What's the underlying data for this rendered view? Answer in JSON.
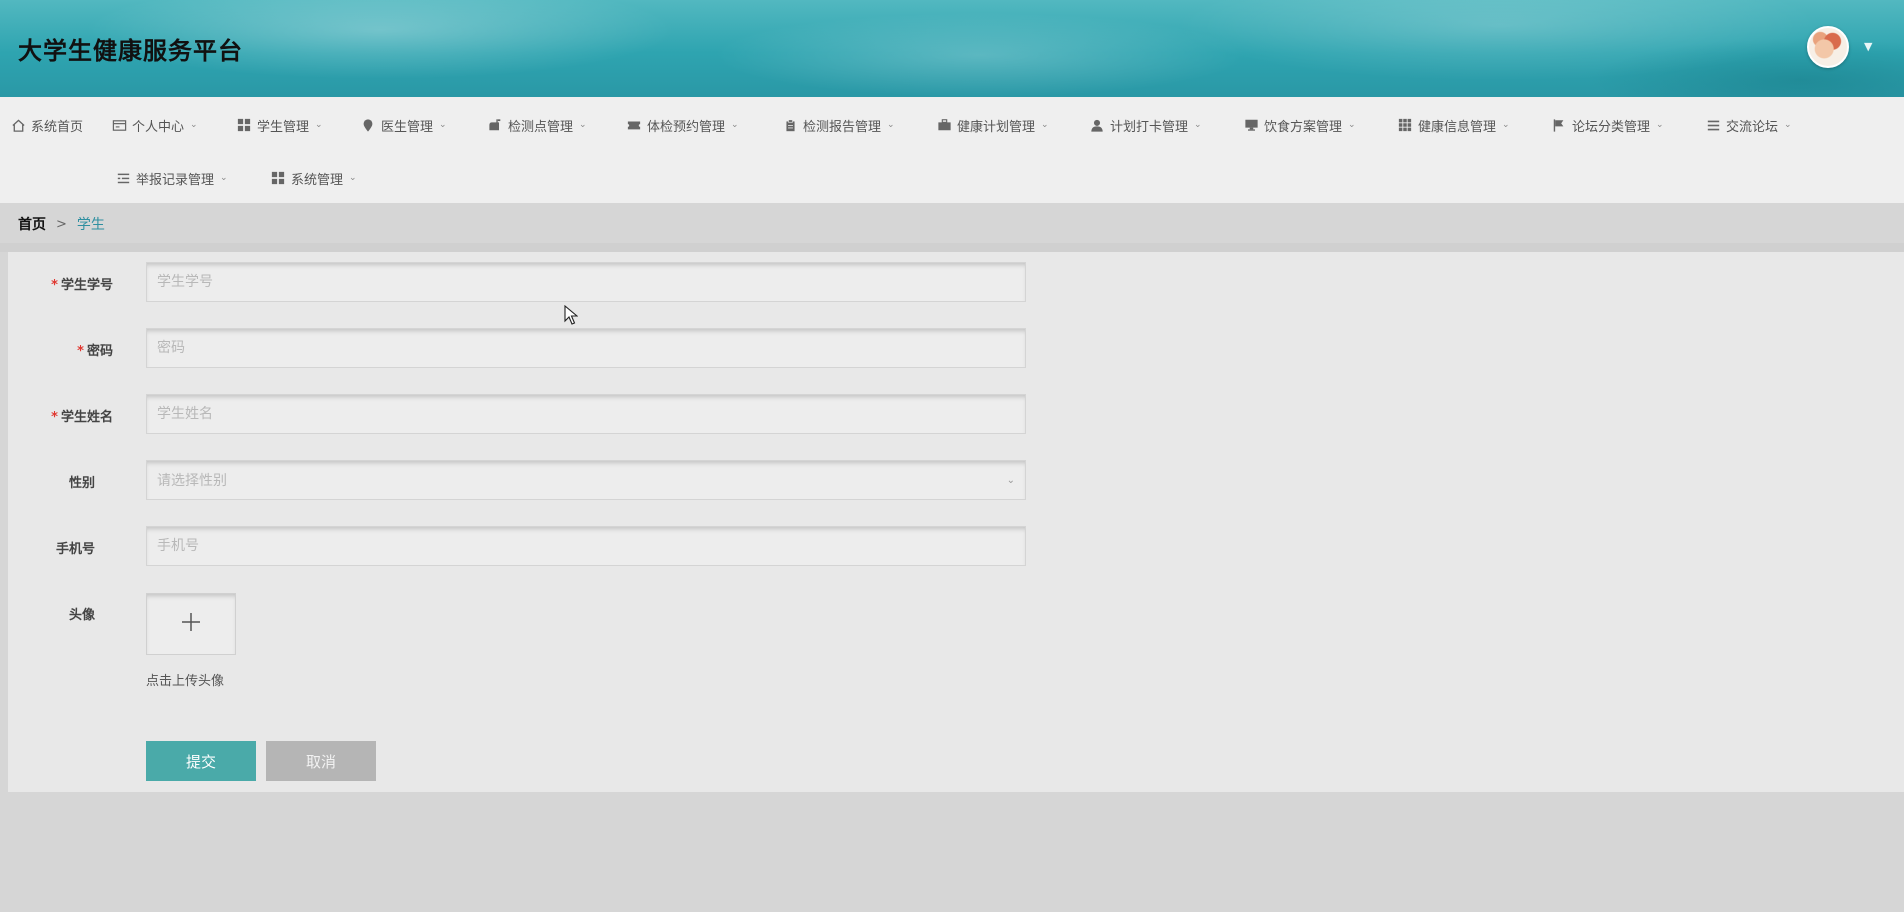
{
  "header": {
    "title": "大学生健康服务平台",
    "avatar_icon": "avatar-image",
    "menu_caret_icon": "caret-down-icon"
  },
  "nav": {
    "items": [
      {
        "label": "系统首页",
        "icon": "home-icon",
        "has_dropdown": false
      },
      {
        "label": "个人中心",
        "icon": "id-card-icon",
        "has_dropdown": true
      },
      {
        "label": "学生管理",
        "icon": "grid-icon",
        "has_dropdown": true
      },
      {
        "label": "医生管理",
        "icon": "map-pin-icon",
        "has_dropdown": true
      },
      {
        "label": "检测点管理",
        "icon": "mailbox-icon",
        "has_dropdown": true
      },
      {
        "label": "体检预约管理",
        "icon": "ticket-icon",
        "has_dropdown": true
      },
      {
        "label": "检测报告管理",
        "icon": "clipboard-icon",
        "has_dropdown": true
      },
      {
        "label": "健康计划管理",
        "icon": "briefcase-icon",
        "has_dropdown": true
      },
      {
        "label": "计划打卡管理",
        "icon": "user-icon",
        "has_dropdown": true
      },
      {
        "label": "饮食方案管理",
        "icon": "monitor-icon",
        "has_dropdown": true
      },
      {
        "label": "健康信息管理",
        "icon": "grid-dots-icon",
        "has_dropdown": true
      },
      {
        "label": "论坛分类管理",
        "icon": "flag-icon",
        "has_dropdown": true
      },
      {
        "label": "交流论坛",
        "icon": "list-icon",
        "has_dropdown": true
      },
      {
        "label": "举报记录管理",
        "icon": "list-details-icon",
        "has_dropdown": true
      },
      {
        "label": "系统管理",
        "icon": "grid-icon",
        "has_dropdown": true
      }
    ],
    "caret": "⌄"
  },
  "breadcrumb": {
    "home": "首页",
    "separator": ">",
    "current": "学生"
  },
  "form": {
    "student_id": {
      "label": "学生学号",
      "required": true,
      "placeholder": "学生学号",
      "value": ""
    },
    "password": {
      "label": "密码",
      "required": true,
      "placeholder": "密码",
      "value": ""
    },
    "student_name": {
      "label": "学生姓名",
      "required": true,
      "placeholder": "学生姓名",
      "value": ""
    },
    "gender": {
      "label": "性别",
      "required": false,
      "placeholder": "请选择性别",
      "value": ""
    },
    "phone": {
      "label": "手机号",
      "required": false,
      "placeholder": "手机号",
      "value": ""
    },
    "avatar": {
      "label": "头像",
      "required": false,
      "upload_hint": "点击上传头像"
    },
    "required_mark": "*",
    "submit_label": "提交",
    "cancel_label": "取消"
  },
  "colors": {
    "header_teal": "#2ea4b0",
    "submit_button": "#4aaaa9",
    "cancel_button": "#b5b5b5",
    "breadcrumb_active": "#2e8fa0",
    "required_star": "#e0362f"
  }
}
